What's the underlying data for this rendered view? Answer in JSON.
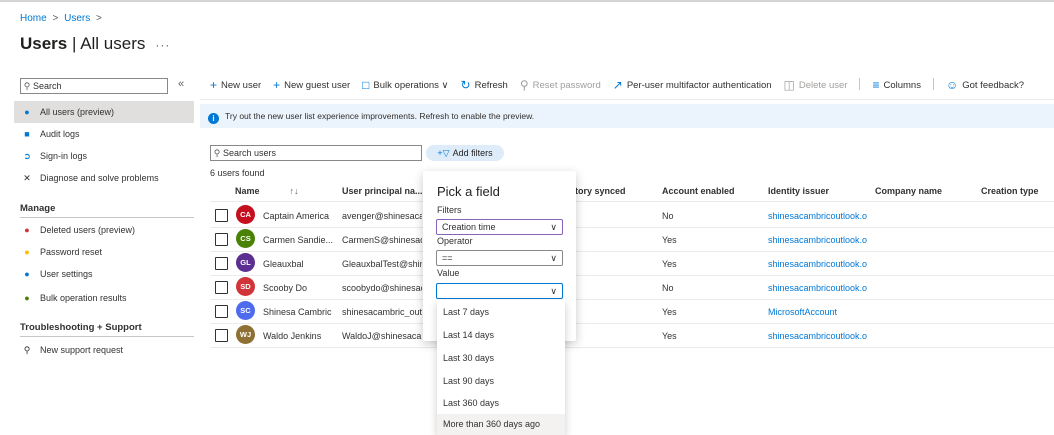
{
  "breadcrumb": {
    "home": "Home",
    "users": "Users",
    "sep": ">"
  },
  "page": {
    "title_bold": "Users",
    "title_rest": " | All users",
    "more": "···"
  },
  "sidebar": {
    "search_placeholder": "Search",
    "collapse": "«",
    "items": [
      {
        "label": "All users (preview)",
        "icon": "users-icon"
      },
      {
        "label": "Audit logs",
        "icon": "audit-log-icon"
      },
      {
        "label": "Sign-in logs",
        "icon": "sign-in-icon"
      },
      {
        "label": "Diagnose and solve problems",
        "icon": "wrench-icon"
      }
    ],
    "manage_heading": "Manage",
    "manage_items": [
      {
        "label": "Deleted users (preview)",
        "icon": "deleted-users-icon"
      },
      {
        "label": "Password reset",
        "icon": "key-icon"
      },
      {
        "label": "User settings",
        "icon": "user-settings-icon"
      },
      {
        "label": "Bulk operation results",
        "icon": "bulk-results-icon"
      }
    ],
    "support_heading": "Troubleshooting + Support",
    "support_items": [
      {
        "label": "New support request",
        "icon": "support-icon"
      }
    ]
  },
  "toolbar": {
    "new_user": "New user",
    "new_guest_user": "New guest user",
    "bulk_operations": "Bulk operations",
    "refresh": "Refresh",
    "reset_password": "Reset password",
    "per_user_mfa": "Per-user multifactor authentication",
    "delete_user": "Delete user",
    "columns": "Columns",
    "got_feedback": "Got feedback?"
  },
  "banner": {
    "text": "Try out the new user list experience improvements. Refresh to enable the preview."
  },
  "search": {
    "placeholder": "Search users",
    "add_filters": "Add filters"
  },
  "results": {
    "count_text": "6 users found"
  },
  "table": {
    "headers": {
      "name": "Name",
      "upn": "User principal na...",
      "dir_synced": "tory synced",
      "account_enabled": "Account enabled",
      "identity_issuer": "Identity issuer",
      "company_name": "Company name",
      "creation_type": "Creation type"
    },
    "sort_icon": "↑↓",
    "rows": [
      {
        "initials": "CA",
        "color": "#c50f1f",
        "name": "Captain America",
        "upn": "avenger@shinesaca",
        "enabled": "No",
        "issuer": "shinesacambricoutlook.o"
      },
      {
        "initials": "CS",
        "color": "#498205",
        "name": "Carmen Sandie...",
        "upn": "CarmenS@shinesac",
        "enabled": "Yes",
        "issuer": "shinesacambricoutlook.o"
      },
      {
        "initials": "GL",
        "color": "#5c2e91",
        "name": "Gleauxbal",
        "upn": "GleauxbalTest@shin",
        "enabled": "Yes",
        "issuer": "shinesacambricoutlook.o"
      },
      {
        "initials": "SD",
        "color": "#d13438",
        "name": "Scooby Do",
        "upn": "scoobydo@shinesac",
        "enabled": "No",
        "issuer": "shinesacambricoutlook.o"
      },
      {
        "initials": "SC",
        "color": "#4f6bed",
        "name": "Shinesa Cambric",
        "upn": "shinesacambric_out",
        "enabled": "Yes",
        "issuer": "MicrosoftAccount"
      },
      {
        "initials": "WJ",
        "color": "#8f7034",
        "name": "Waldo Jenkins",
        "upn": "WaldoJ@shinesacar",
        "enabled": "Yes",
        "issuer": "shinesacambricoutlook.o"
      }
    ]
  },
  "filter_popup": {
    "title": "Pick a field",
    "filters_label": "Filters",
    "filters_value": "Creation time",
    "operator_label": "Operator",
    "operator_value": "==",
    "value_label": "Value",
    "value_value": "",
    "chevron": "∨",
    "options": [
      "Last 7 days",
      "Last 14 days",
      "Last 30 days",
      "Last 90 days",
      "Last 360 days",
      "More than 360 days ago"
    ]
  }
}
